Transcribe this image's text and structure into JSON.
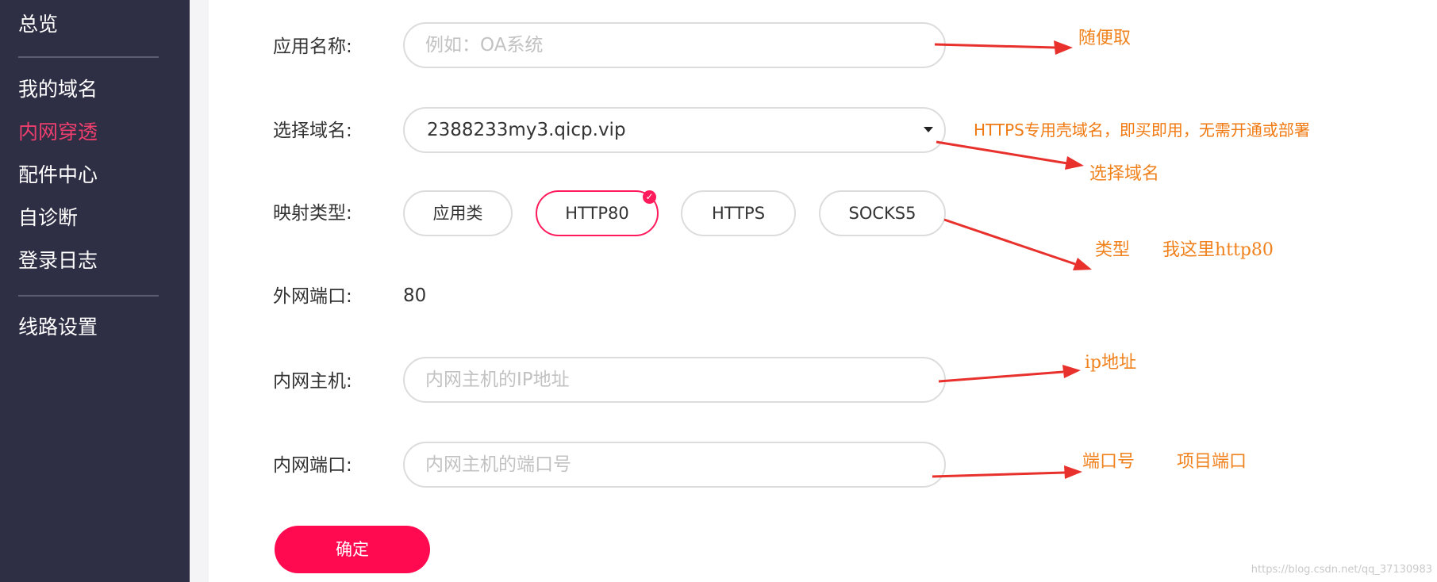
{
  "sidebar": {
    "top_item": "总览",
    "items": [
      "我的域名",
      "内网穿透",
      "配件中心",
      "自诊断",
      "登录日志"
    ],
    "bottom_item": "线路设置"
  },
  "form": {
    "app_name_label": "应用名称:",
    "app_name_placeholder": "例如：OA系统",
    "domain_label": "选择域名:",
    "domain_value": "2388233my3.qicp.vip",
    "mapping_type_label": "映射类型:",
    "mapping_types": [
      "应用类",
      "HTTP80",
      "HTTPS",
      "SOCKS5"
    ],
    "selected_mapping_type": "HTTP80",
    "external_port_label": "外网端口:",
    "external_port_value": "80",
    "internal_host_label": "内网主机:",
    "internal_host_placeholder": "内网主机的IP地址",
    "internal_port_label": "内网端口:",
    "internal_port_placeholder": "内网主机的端口号",
    "confirm_label": "确定"
  },
  "annotations": {
    "app_name_note": "随便取",
    "domain_note_top": "HTTPS专用壳域名，即买即用，无需开通或部署",
    "domain_note": "选择域名",
    "type_note": "类型",
    "type_note_detail": "我这里http80",
    "host_note": "ip地址",
    "port_note": "端口号",
    "port_note_detail": "项目端口"
  },
  "watermark": "https://blog.csdn.net/qq_37130983",
  "colors": {
    "sidebar_bg": "#2e2f45",
    "accent": "#ff0a50",
    "annotation": "#f0821e",
    "arrow": "#e8312c"
  }
}
